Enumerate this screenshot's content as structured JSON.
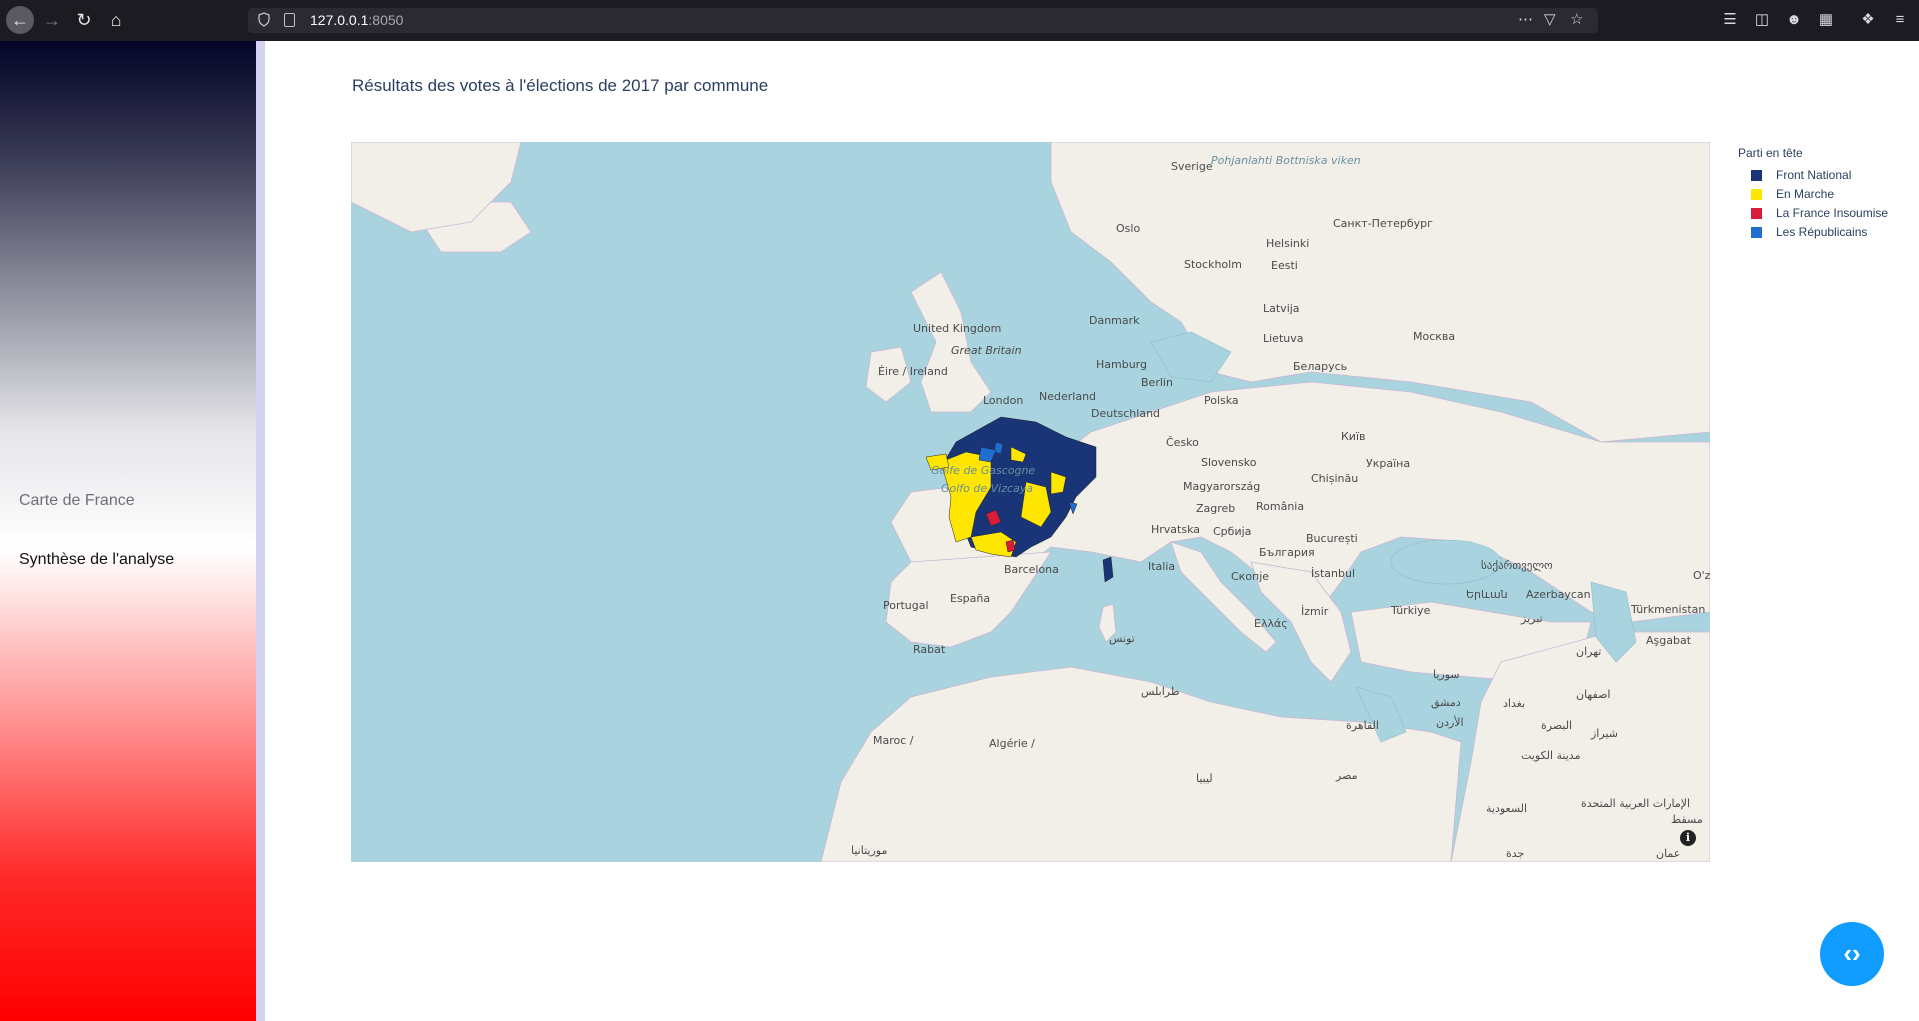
{
  "browser": {
    "url_host": "127.0.0.1",
    "url_port": ":8050"
  },
  "sidebar": {
    "items": [
      {
        "label": "Carte de France"
      },
      {
        "label": "Synthèse de l'analyse"
      }
    ]
  },
  "main": {
    "title": "Résultats des votes à l'élections de 2017 par commune"
  },
  "legend": {
    "title": "Parti en tête",
    "items": [
      {
        "label": "Front National",
        "color": "#1a3478"
      },
      {
        "label": "En Marche",
        "color": "#ffe600"
      },
      {
        "label": "La France Insoumise",
        "color": "#d81d3b"
      },
      {
        "label": "Les Républicains",
        "color": "#1e6fd0"
      }
    ]
  },
  "map": {
    "labels": {
      "sverige": "Sverige",
      "oslo": "Oslo",
      "stockholm": "Stockholm",
      "helsinki": "Helsinki",
      "spb": "Санкт-Петербург",
      "eesti": "Eesti",
      "latvija": "Latvija",
      "lietuva": "Lietuva",
      "moskva": "Москва",
      "belarus": "Беларусь",
      "danmark": "Danmark",
      "uk": "United Kingdom",
      "gb": "Great Britain",
      "eire": "Éire / Ireland",
      "london": "London",
      "nederland": "Nederland",
      "hamburg": "Hamburg",
      "berlin": "Berlin",
      "deutschland": "Deutschland",
      "polska": "Polska",
      "kyiv": "Київ",
      "ukraina": "Україна",
      "cesko": "Česko",
      "slovensko": "Slovensko",
      "magyar": "Magyarország",
      "chisinau": "Chișinău",
      "romania": "România",
      "zagreb": "Zagreb",
      "hrvatska": "Hrvatska",
      "srbija": "Србија",
      "bucuresti": "București",
      "bulgaria": "България",
      "istanbul": "İstanbul",
      "italia": "Italia",
      "skopje": "Скопје",
      "barcelona": "Barcelona",
      "espana": "España",
      "portugal": "Portugal",
      "ellada": "Ελλάς",
      "izmir": "İzmir",
      "turkiye": "Türkiye",
      "georgia": "საქართველო",
      "yerevan": "Երևան",
      "azerbaycan": "Azerbaycan",
      "turkmenistan": "Türkmenistan",
      "asgabat": "Aşgabat",
      "tabriz": "تبریز",
      "tehran": "تهران",
      "rabat": "Rabat",
      "tunis": "تونس",
      "tarabulus": "طرابلس",
      "maroc": "Maroc /",
      "algerie": "Algérie /",
      "libya": "ليبيا",
      "misr": "مصر",
      "qahira": "القاهرة",
      "saudi": "السعودية",
      "kuwait": "مدينة الكويت",
      "basra": "البصرة",
      "baghdad": "بغداد",
      "dimashq": "دمشق",
      "suriya": "سوريا",
      "urdun": "الأردن",
      "isfahan": "اصفهان",
      "shiraz": "شیراز",
      "emirates": "الإمارات العربية المتحدة",
      "muscat": "مسقط",
      "oman": "عمان",
      "jiddah": "جدة",
      "mauritania": "موريتانيا",
      "golfe": "Golfe de Gascogne",
      "golfo": "Golfo de Vizcaya",
      "bothnia": "Pohjanlahti Bottniska viken",
      "oz": "O'z"
    }
  }
}
